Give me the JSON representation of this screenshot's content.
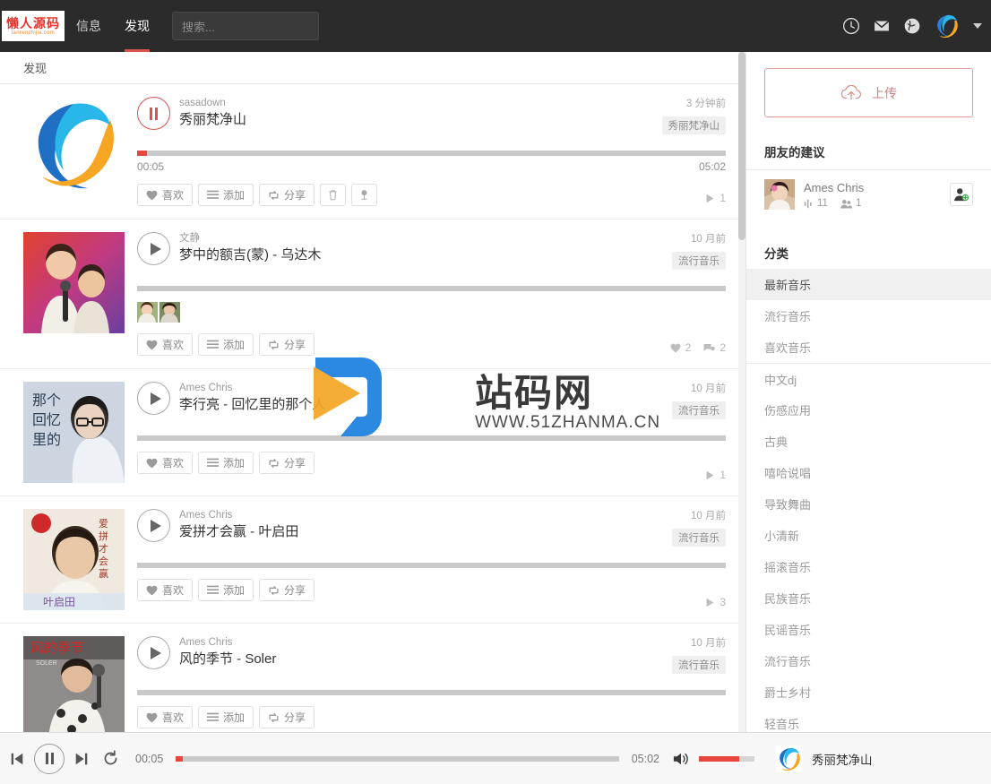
{
  "nav": {
    "logo_line1": "懒人源码",
    "logo_line2": "lanrenzhijia.com",
    "tabs": [
      {
        "label": "信息",
        "active": false
      },
      {
        "label": "发现",
        "active": true
      }
    ],
    "search_placeholder": "搜索...",
    "icons": [
      "clock-icon",
      "mail-icon",
      "globe-icon"
    ],
    "avatar": "user-avatar",
    "caret": "chevron-down-icon"
  },
  "page": {
    "heading": "发现"
  },
  "tracks": [
    {
      "artist": "sasadown",
      "title": "秀丽梵净山",
      "ago": "3 分钟前",
      "tag": "秀丽梵净山",
      "current_time": "00:05",
      "duration": "05:02",
      "progress_percent": 1.6,
      "playing": true,
      "buttons": [
        "喜欢",
        "添加",
        "分享"
      ],
      "extra_buttons": [
        "trash-icon",
        "mic-icon"
      ],
      "stats": [
        {
          "icon": "play-icon",
          "value": "1"
        }
      ],
      "thumbs": 0,
      "cover": "logo-swirl"
    },
    {
      "artist": "文静",
      "title": "梦中的额吉(蒙) - 乌达木",
      "ago": "10 月前",
      "tag": "流行音乐",
      "current_time": "",
      "duration": "",
      "progress_percent": 0,
      "playing": false,
      "buttons": [
        "喜欢",
        "添加",
        "分享"
      ],
      "extra_buttons": [],
      "stats": [
        {
          "icon": "heart-icon",
          "value": "2"
        },
        {
          "icon": "comment-icon",
          "value": "2"
        }
      ],
      "thumbs": 2,
      "cover": "photo-duet"
    },
    {
      "artist": "Ames Chris",
      "title": "李行亮 - 回忆里的那个人",
      "ago": "10 月前",
      "tag": "流行音乐",
      "current_time": "",
      "duration": "",
      "progress_percent": 0,
      "playing": false,
      "buttons": [
        "喜欢",
        "添加",
        "分享"
      ],
      "extra_buttons": [],
      "stats": [
        {
          "icon": "play-icon",
          "value": "1"
        }
      ],
      "thumbs": 0,
      "cover": "photo-lixingliang"
    },
    {
      "artist": "Ames Chris",
      "title": "爱拼才会赢 - 叶启田",
      "ago": "10 月前",
      "tag": "流行音乐",
      "current_time": "",
      "duration": "",
      "progress_percent": 0,
      "playing": false,
      "buttons": [
        "喜欢",
        "添加",
        "分享"
      ],
      "extra_buttons": [],
      "stats": [
        {
          "icon": "play-icon",
          "value": "3"
        }
      ],
      "thumbs": 0,
      "cover": "photo-yeqitian"
    },
    {
      "artist": "Ames Chris",
      "title": "风的季节 - Soler",
      "ago": "10 月前",
      "tag": "流行音乐",
      "current_time": "",
      "duration": "",
      "progress_percent": 0,
      "playing": false,
      "buttons": [
        "喜欢",
        "添加",
        "分享"
      ],
      "extra_buttons": [],
      "stats": [],
      "thumbs": 0,
      "cover": "photo-soler"
    }
  ],
  "sidebar": {
    "upload_label": "上传",
    "friends_heading": "朋友的建议",
    "friend": {
      "name": "Ames Chris",
      "tracks_count": "11",
      "followers_count": "1",
      "add_icon": "add-user-icon"
    },
    "categories_heading": "分类",
    "categories": [
      {
        "label": "最新音乐",
        "active": true,
        "separator": false
      },
      {
        "label": "流行音乐",
        "active": false,
        "separator": false
      },
      {
        "label": "喜欢音乐",
        "active": false,
        "separator": false
      },
      {
        "label": "中文dj",
        "active": false,
        "separator": true
      },
      {
        "label": "伤感应用",
        "active": false,
        "separator": false
      },
      {
        "label": "古典",
        "active": false,
        "separator": false
      },
      {
        "label": "嘻哈说唱",
        "active": false,
        "separator": false
      },
      {
        "label": "导致舞曲",
        "active": false,
        "separator": false
      },
      {
        "label": "小清新",
        "active": false,
        "separator": false
      },
      {
        "label": "摇滚音乐",
        "active": false,
        "separator": false
      },
      {
        "label": "民族音乐",
        "active": false,
        "separator": false
      },
      {
        "label": "民谣音乐",
        "active": false,
        "separator": false
      },
      {
        "label": "流行音乐",
        "active": false,
        "separator": false
      },
      {
        "label": "爵士乡村",
        "active": false,
        "separator": false
      },
      {
        "label": "轻音乐",
        "active": false,
        "separator": false
      }
    ]
  },
  "player": {
    "current_time": "00:05",
    "duration": "05:02",
    "progress_percent": 1.6,
    "volume_percent": 72,
    "now_playing_title": "秀丽梵净山",
    "controls": [
      "prev-icon",
      "pause-icon",
      "next-icon",
      "repeat-icon"
    ],
    "volume_icon": "volume-icon"
  },
  "watermark": {
    "title": "站码网",
    "url": "WWW.51ZHANMA.CN"
  },
  "colors": {
    "accent_red": "#e8453c",
    "nav_bg": "#2b2b2b",
    "upload_border": "#e39b98"
  }
}
